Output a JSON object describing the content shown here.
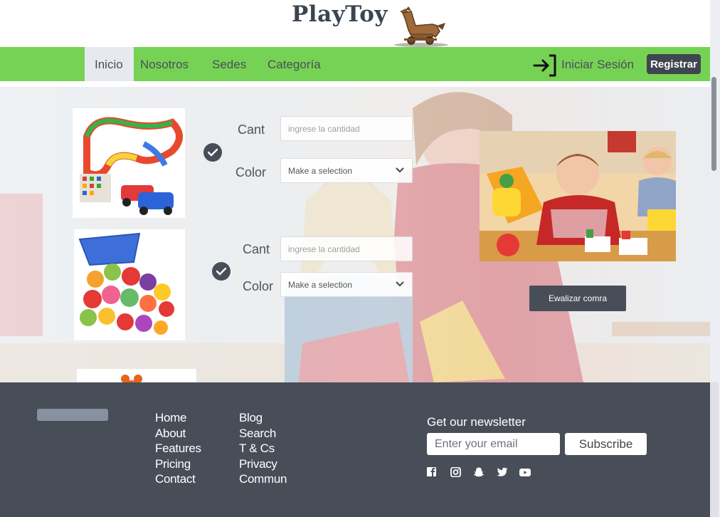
{
  "brand": {
    "name": "PlayToy"
  },
  "nav": {
    "items": [
      {
        "label": "Inicio",
        "active": true
      },
      {
        "label": "Nosotros"
      },
      {
        "label": "Sedes"
      },
      {
        "label": "Categoría"
      }
    ],
    "login_label": "Iniciar Sesión",
    "register_label": "Registrar"
  },
  "order_form": {
    "products": [
      {
        "icon": "race-track-toy-image",
        "cant_label": "Cant",
        "cant_placeholder": "ingrese la cantidad",
        "color_label": "Color",
        "color_value": "Make a selection"
      },
      {
        "icon": "fruit-basket-toy-image",
        "cant_label": "Cant",
        "cant_placeholder": "ingrese la cantidad",
        "color_label": "Color",
        "color_value": "Make a selection"
      }
    ],
    "finalize_label": "Ewalizar comra"
  },
  "footer": {
    "col1": [
      "Home",
      "About",
      "Features",
      "Pricing",
      "Contact"
    ],
    "col2": [
      "Blog",
      "Search",
      "T & Cs",
      "Privacy",
      "Commun"
    ],
    "newsletter": {
      "title": "Get our newsletter",
      "placeholder": "Enter your email",
      "button": "Subscribe"
    },
    "social": [
      "facebook-icon",
      "instagram-icon",
      "snapchat-icon",
      "twitter-icon",
      "youtube-icon"
    ]
  },
  "colors": {
    "nav_green": "#76d255",
    "dark": "#474e58",
    "button_dark": "#3f4650"
  }
}
